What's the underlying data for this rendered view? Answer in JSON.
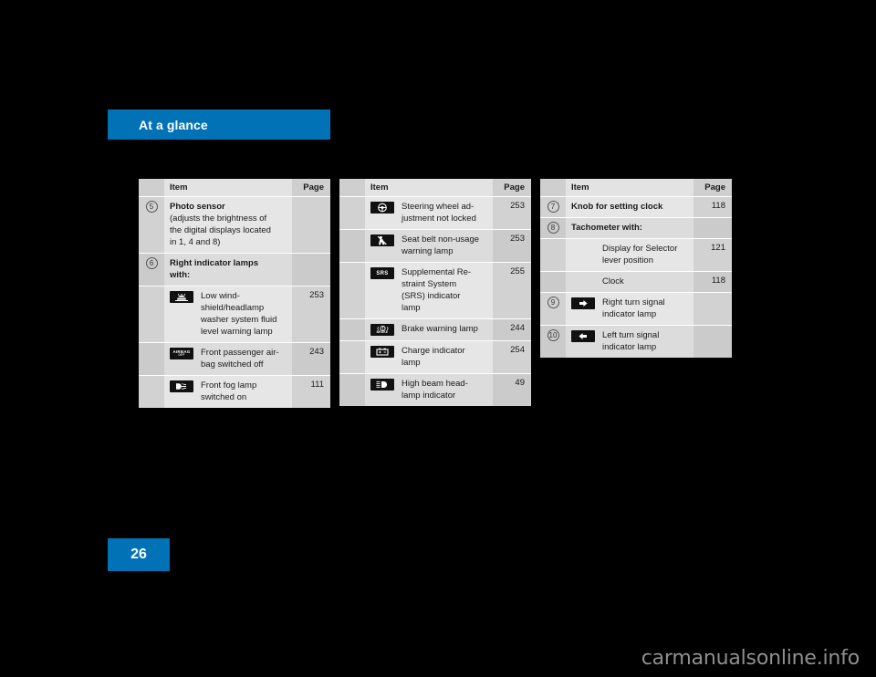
{
  "chapter": {
    "title": "At a glance"
  },
  "page": {
    "number": "26"
  },
  "watermark": {
    "text": "carmanualsonline.info"
  },
  "columns": {
    "item": "Item",
    "page": "Page"
  },
  "tables": [
    {
      "id": "table-left",
      "rows": [
        {
          "num": "5",
          "bold": "Photo sensor",
          "lines": [
            "(adjusts the brightness of",
            "the digital displays located",
            "in 1, 4 and 8)"
          ],
          "page": ""
        },
        {
          "num": "6",
          "bold_lines": [
            "Right indicator lamps",
            "with:"
          ],
          "page": ""
        },
        {
          "num": "",
          "icon": "washer-fluid-icon",
          "lines": [
            "Low wind-",
            "shield/headlamp",
            "washer system fluid",
            "level warning lamp"
          ],
          "page": "253"
        },
        {
          "num": "",
          "icon": "airbag-off-icon",
          "lines": [
            "Front passenger air-",
            "bag switched off"
          ],
          "page": "243"
        },
        {
          "num": "",
          "icon": "fog-lamp-icon",
          "lines": [
            "Front fog lamp",
            "switched on"
          ],
          "page": "111"
        }
      ]
    },
    {
      "id": "table-middle",
      "rows": [
        {
          "num": "",
          "icon": "steering-wheel-icon",
          "lines": [
            "Steering wheel ad-",
            "justment not locked"
          ],
          "page": "253"
        },
        {
          "num": "",
          "icon": "seat-belt-icon",
          "lines": [
            "Seat belt non-usage",
            "warning lamp"
          ],
          "page": "253"
        },
        {
          "num": "",
          "icon": "srs-icon",
          "lines": [
            "Supplemental Re-",
            "straint System",
            "(SRS) indicator",
            "lamp"
          ],
          "page": "255"
        },
        {
          "num": "",
          "icon": "brake-warning-icon",
          "lines": [
            "Brake warning lamp"
          ],
          "page": "244"
        },
        {
          "num": "",
          "icon": "charge-battery-icon",
          "lines": [
            "Charge indicator",
            "lamp"
          ],
          "page": "254"
        },
        {
          "num": "",
          "icon": "high-beam-icon",
          "lines": [
            "High beam head-",
            "lamp indicator"
          ],
          "page": "49"
        }
      ]
    },
    {
      "id": "table-right",
      "rows": [
        {
          "num": "7",
          "bold": "Knob for setting clock",
          "page": "118"
        },
        {
          "num": "8",
          "bold": "Tachometer with:",
          "page": ""
        },
        {
          "num": "",
          "indent": true,
          "lines": [
            "Display for Selector",
            "lever position"
          ],
          "page": "121"
        },
        {
          "num": "",
          "indent": true,
          "lines": [
            "Clock"
          ],
          "page": "118"
        },
        {
          "num": "9",
          "icon": "right-turn-signal-icon",
          "lines": [
            "Right turn signal",
            "indicator lamp"
          ],
          "page": ""
        },
        {
          "num": "10",
          "icon": "left-turn-signal-icon",
          "lines": [
            "Left turn signal",
            "indicator lamp"
          ],
          "page": ""
        }
      ]
    }
  ],
  "colors": {
    "brand_blue": "#0072b5",
    "page_background": "#000000",
    "table_row_light": "#e6e6e6",
    "table_row_dark": "#dcdcdc",
    "table_gutter": "#d2d2d2",
    "icon_chip": "#111111"
  }
}
